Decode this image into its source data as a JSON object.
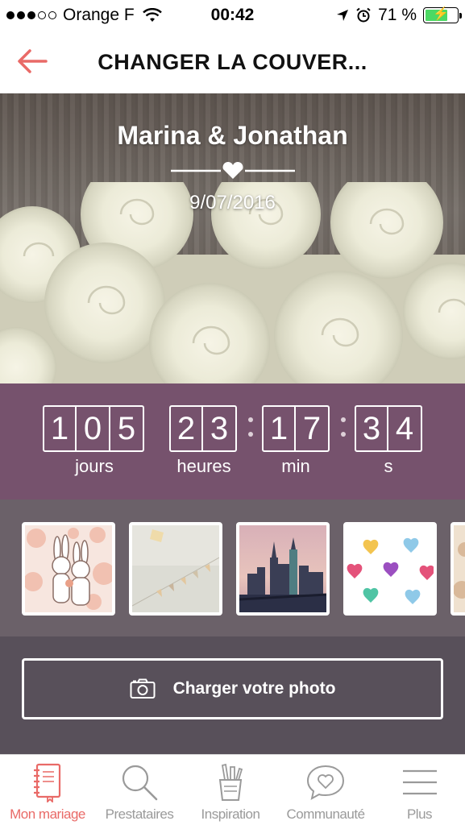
{
  "status_bar": {
    "carrier": "Orange F",
    "time": "00:42",
    "battery_percent": "71 %",
    "battery_level": 0.71,
    "signal_bars_filled": 3,
    "signal_bars_total": 5
  },
  "nav": {
    "title": "CHANGER LA COUVER..."
  },
  "cover": {
    "names": "Marina & Jonathan",
    "date": "9/07/2016"
  },
  "countdown": {
    "days": [
      "1",
      "0",
      "5"
    ],
    "hours": [
      "2",
      "3"
    ],
    "minutes": [
      "1",
      "7"
    ],
    "seconds": [
      "3",
      "4"
    ],
    "labels": {
      "days": "jours",
      "hours": "heures",
      "minutes": "min",
      "seconds": "s"
    }
  },
  "thumbnails": [
    {
      "name": "bunnies-couple"
    },
    {
      "name": "bunting-garland"
    },
    {
      "name": "city-skyline"
    },
    {
      "name": "watercolor-hearts"
    },
    {
      "name": "floral-partial"
    }
  ],
  "upload": {
    "label": "Charger votre photo"
  },
  "tabs": [
    {
      "label": "Mon mariage",
      "icon": "notebook-icon",
      "active": true
    },
    {
      "label": "Prestataires",
      "icon": "search-icon",
      "active": false
    },
    {
      "label": "Inspiration",
      "icon": "pencil-cup-icon",
      "active": false
    },
    {
      "label": "Communauté",
      "icon": "chat-heart-icon",
      "active": false
    },
    {
      "label": "Plus",
      "icon": "menu-icon",
      "active": false
    }
  ],
  "colors": {
    "accent": "#e96a67",
    "countdown_bg": "#76526d",
    "thumbs_bg": "#6b6169",
    "upload_bg": "#58505a"
  }
}
